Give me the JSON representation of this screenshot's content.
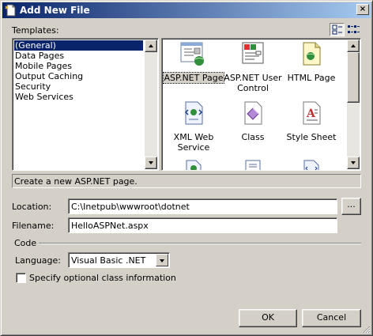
{
  "window": {
    "title": "Add New File",
    "close_glyph": "×"
  },
  "templates": {
    "label": "Templates:",
    "view_buttons": [
      {
        "icon": "large-icons-view-icon"
      },
      {
        "icon": "small-icons-view-icon"
      }
    ],
    "categories": [
      {
        "label": "(General)",
        "selected": true
      },
      {
        "label": "Data Pages",
        "selected": false
      },
      {
        "label": "Mobile Pages",
        "selected": false
      },
      {
        "label": "Output Caching",
        "selected": false
      },
      {
        "label": "Security",
        "selected": false
      },
      {
        "label": "Web Services",
        "selected": false
      }
    ],
    "items": [
      {
        "label": "ASP.NET Page",
        "icon": "aspnet-page-icon",
        "selected": true
      },
      {
        "label": "ASP.NET User Control",
        "icon": "aspnet-user-control-icon",
        "selected": false
      },
      {
        "label": "HTML Page",
        "icon": "html-page-icon",
        "selected": false
      },
      {
        "label": "XML Web Service",
        "icon": "xml-web-service-icon",
        "selected": false
      },
      {
        "label": "Class",
        "icon": "class-icon",
        "selected": false
      },
      {
        "label": "Style Sheet",
        "icon": "style-sheet-icon",
        "selected": false
      }
    ]
  },
  "description": "Create a new ASP.NET page.",
  "location": {
    "label": "Location:",
    "value": "C:\\Inetpub\\wwwroot\\dotnet",
    "browse_label": "..."
  },
  "filename": {
    "label": "Filename:",
    "value": "HelloASPNet.aspx"
  },
  "code": {
    "section_label": "Code",
    "language_label": "Language:",
    "language_value": "Visual Basic .NET",
    "class_info_label": "Specify optional class information",
    "class_info_checked": false
  },
  "buttons": {
    "ok": "OK",
    "cancel": "Cancel"
  },
  "colors": {
    "title_start": "#0a246a",
    "title_end": "#a6caf0",
    "face": "#d4d0c8",
    "selection": "#0a246a"
  }
}
